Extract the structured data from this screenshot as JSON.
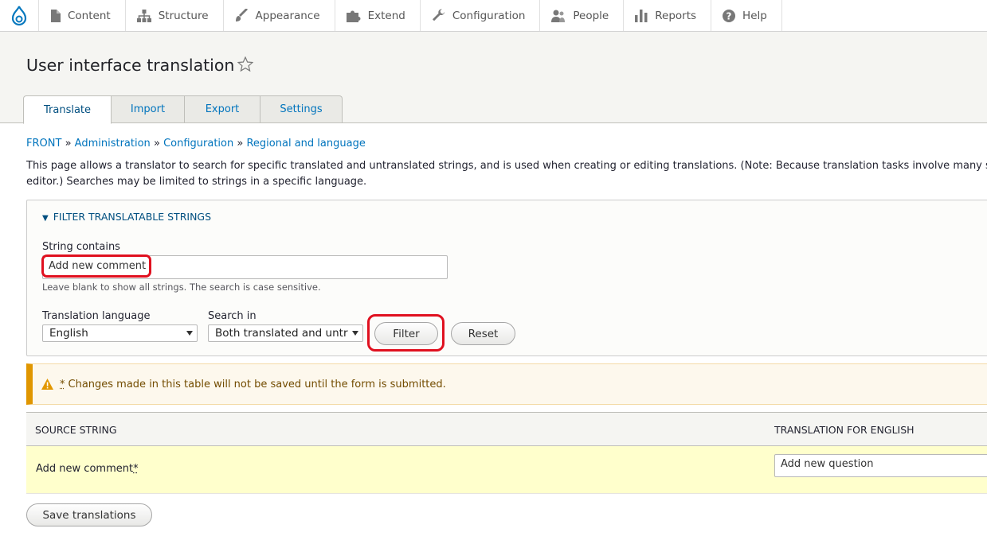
{
  "toolbar": {
    "items": [
      {
        "label": "Content",
        "icon": "file-icon"
      },
      {
        "label": "Structure",
        "icon": "sitemap-icon"
      },
      {
        "label": "Appearance",
        "icon": "paintbrush-icon"
      },
      {
        "label": "Extend",
        "icon": "puzzle-icon"
      },
      {
        "label": "Configuration",
        "icon": "wrench-icon"
      },
      {
        "label": "People",
        "icon": "people-icon"
      },
      {
        "label": "Reports",
        "icon": "bar-chart-icon"
      },
      {
        "label": "Help",
        "icon": "help-icon"
      }
    ]
  },
  "header": {
    "title": "User interface translation",
    "tabs": [
      {
        "label": "Translate",
        "active": true
      },
      {
        "label": "Import"
      },
      {
        "label": "Export"
      },
      {
        "label": "Settings"
      }
    ]
  },
  "breadcrumb": {
    "items": [
      "FRONT",
      "Administration",
      "Configuration",
      "Regional and language"
    ],
    "separator": "»"
  },
  "description": "This page allows a translator to search for specific translated and untranslated strings, and is used when creating or editing translations. (Note: Because translation tasks involve many strings,",
  "description_line2": "editor.) Searches may be limited to strings in a specific language.",
  "filter": {
    "legend": "Filter translatable strings",
    "string_contains_label": "String contains",
    "string_contains_value": "Add new comment",
    "help_text": "Leave blank to show all strings. The search is case sensitive.",
    "language_label": "Translation language",
    "language_value": "English",
    "search_in_label": "Search in",
    "search_in_value": "Both translated and untr",
    "filter_button": "Filter",
    "reset_button": "Reset"
  },
  "warning": {
    "asterisk": "*",
    "message": "Changes made in this table will not be saved until the form is submitted."
  },
  "table": {
    "headers": [
      "Source string",
      "Translation for English"
    ],
    "rows": [
      {
        "source": "Add new comment",
        "marker": "*",
        "translation": "Add new question"
      }
    ]
  },
  "save_button": "Save translations",
  "colors": {
    "link": "#0074bd",
    "annotation": "#e0101f",
    "warning_border": "#e09600",
    "row_highlight": "#ffffcc"
  }
}
